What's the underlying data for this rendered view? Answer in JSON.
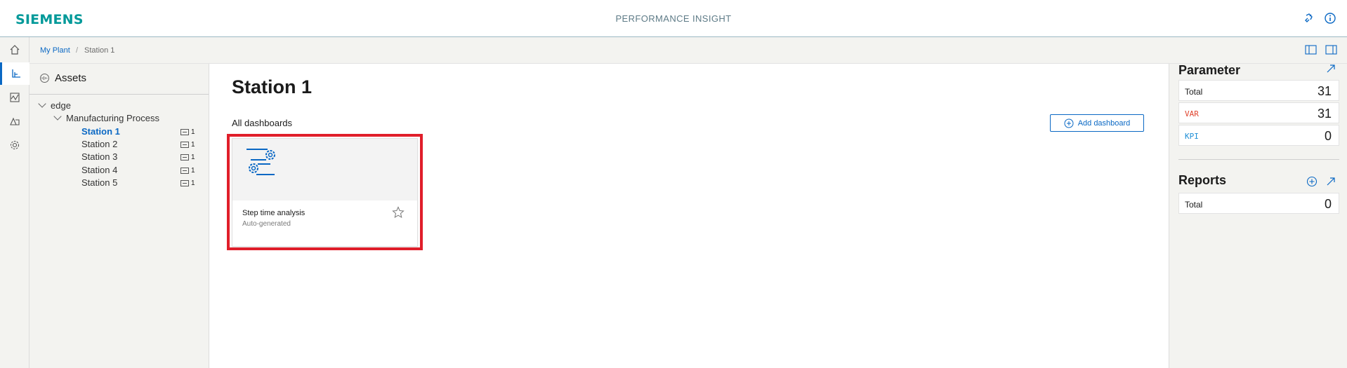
{
  "header": {
    "brand": "SIEMENS",
    "app_title": "PERFORMANCE INSIGHT",
    "icons": [
      "plugin-icon",
      "info-icon"
    ]
  },
  "rail": {
    "items": [
      {
        "name": "home-icon",
        "active": false
      },
      {
        "name": "assets-icon",
        "active": true
      },
      {
        "name": "analysis-icon",
        "active": false
      },
      {
        "name": "reports-icon",
        "active": false
      },
      {
        "name": "settings-icon",
        "active": false
      }
    ]
  },
  "breadcrumb": {
    "root": "My Plant",
    "separator": "/",
    "current": "Station 1"
  },
  "tree": {
    "title": "Assets",
    "root": "edge",
    "group": "Manufacturing Process",
    "stations": [
      {
        "label": "Station 1",
        "count": "1",
        "selected": true
      },
      {
        "label": "Station 2",
        "count": "1",
        "selected": false
      },
      {
        "label": "Station 3",
        "count": "1",
        "selected": false
      },
      {
        "label": "Station 4",
        "count": "1",
        "selected": false
      },
      {
        "label": "Station 5",
        "count": "1",
        "selected": false
      }
    ]
  },
  "main": {
    "title": "Station 1",
    "section_label": "All dashboards",
    "add_button": "Add dashboard",
    "card": {
      "title": "Step time analysis",
      "subtitle": "Auto-generated"
    }
  },
  "parameter": {
    "title": "Parameter",
    "rows": [
      {
        "key": "Total",
        "value": "31",
        "color": "#1b1b1b"
      },
      {
        "key": "VAR",
        "value": "31",
        "color": "#e0442e"
      },
      {
        "key": "KPI",
        "value": "0",
        "color": "#1f8fd6"
      }
    ]
  },
  "reports": {
    "title": "Reports",
    "rows": [
      {
        "key": "Total",
        "value": "0"
      }
    ]
  },
  "colors": {
    "brand": "#009999",
    "accent": "#0a68c4",
    "highlight": "#e01e2a"
  }
}
